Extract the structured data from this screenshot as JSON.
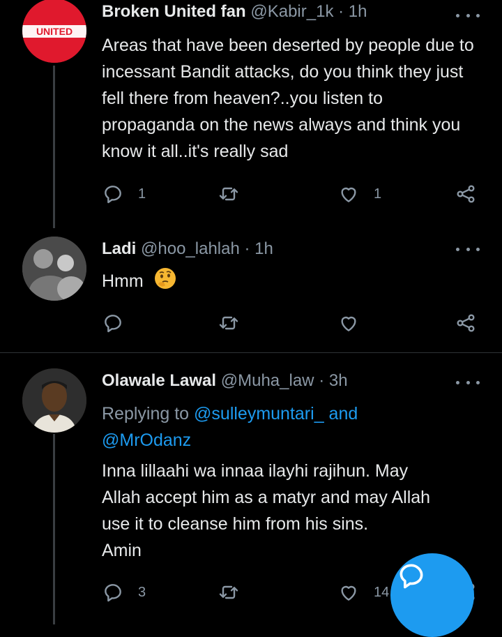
{
  "tweets": [
    {
      "name": "Broken United fan",
      "handle": "@Kabir_1k",
      "time": "· 1h",
      "text": "Areas that have been deserted by people due to incessant Bandit attacks, do you think they just fell there from heaven?..you listen to propaganda on the news always and think you know it all..it's really sad",
      "replies": "1",
      "retweets": "",
      "likes": "1",
      "avatar_text": "UNITED",
      "avatar_color": "#e0192d"
    },
    {
      "name": "Ladi",
      "handle": "@hoo_lahlah",
      "time": "· 1h",
      "text": "Hmm",
      "emoji": "thinking-face",
      "replies": "",
      "retweets": "",
      "likes": ""
    },
    {
      "name": "Olawale Lawal",
      "handle": "@Muha_law",
      "time": "· 3h",
      "replying_prefix": "Replying to",
      "replying_mention_1": "@sulleymuntari_",
      "replying_and": "and",
      "replying_mention_2": "@MrOdanz",
      "text_lines": [
        "Inna lillaahi wa innaa ilayhi rajihun. May",
        "Allah accept him as a matyr and may Allah",
        "use it to cleanse him from his sins.",
        "Amin"
      ],
      "replies": "3",
      "retweets": "",
      "likes": "14"
    }
  ],
  "colors": {
    "background": "#000000",
    "text": "#e7e9ea",
    "muted": "#8b98a5",
    "accent": "#1d9bf0"
  },
  "icons": [
    "reply-icon",
    "retweet-icon",
    "like-icon",
    "share-icon",
    "more-icon",
    "compose-reply-icon"
  ]
}
